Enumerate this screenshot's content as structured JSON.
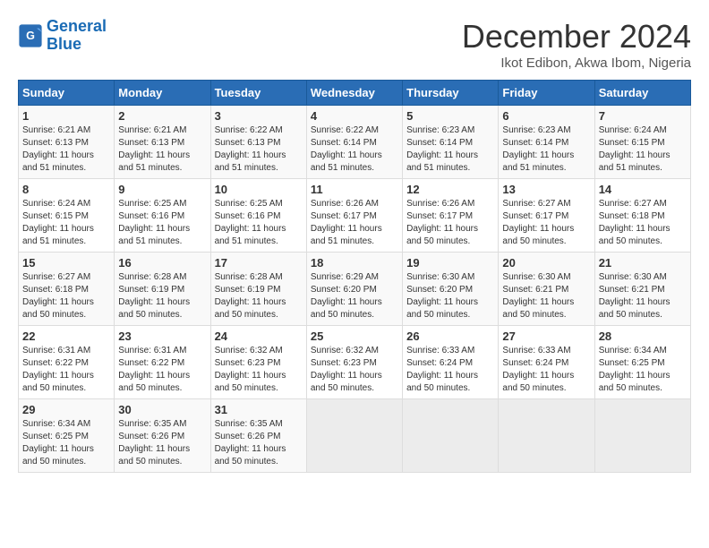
{
  "header": {
    "logo_line1": "General",
    "logo_line2": "Blue",
    "title": "December 2024",
    "location": "Ikot Edibon, Akwa Ibom, Nigeria"
  },
  "weekdays": [
    "Sunday",
    "Monday",
    "Tuesday",
    "Wednesday",
    "Thursday",
    "Friday",
    "Saturday"
  ],
  "weeks": [
    [
      {
        "day": "1",
        "info": "Sunrise: 6:21 AM\nSunset: 6:13 PM\nDaylight: 11 hours\nand 51 minutes."
      },
      {
        "day": "2",
        "info": "Sunrise: 6:21 AM\nSunset: 6:13 PM\nDaylight: 11 hours\nand 51 minutes."
      },
      {
        "day": "3",
        "info": "Sunrise: 6:22 AM\nSunset: 6:13 PM\nDaylight: 11 hours\nand 51 minutes."
      },
      {
        "day": "4",
        "info": "Sunrise: 6:22 AM\nSunset: 6:14 PM\nDaylight: 11 hours\nand 51 minutes."
      },
      {
        "day": "5",
        "info": "Sunrise: 6:23 AM\nSunset: 6:14 PM\nDaylight: 11 hours\nand 51 minutes."
      },
      {
        "day": "6",
        "info": "Sunrise: 6:23 AM\nSunset: 6:14 PM\nDaylight: 11 hours\nand 51 minutes."
      },
      {
        "day": "7",
        "info": "Sunrise: 6:24 AM\nSunset: 6:15 PM\nDaylight: 11 hours\nand 51 minutes."
      }
    ],
    [
      {
        "day": "8",
        "info": "Sunrise: 6:24 AM\nSunset: 6:15 PM\nDaylight: 11 hours\nand 51 minutes."
      },
      {
        "day": "9",
        "info": "Sunrise: 6:25 AM\nSunset: 6:16 PM\nDaylight: 11 hours\nand 51 minutes."
      },
      {
        "day": "10",
        "info": "Sunrise: 6:25 AM\nSunset: 6:16 PM\nDaylight: 11 hours\nand 51 minutes."
      },
      {
        "day": "11",
        "info": "Sunrise: 6:26 AM\nSunset: 6:17 PM\nDaylight: 11 hours\nand 51 minutes."
      },
      {
        "day": "12",
        "info": "Sunrise: 6:26 AM\nSunset: 6:17 PM\nDaylight: 11 hours\nand 50 minutes."
      },
      {
        "day": "13",
        "info": "Sunrise: 6:27 AM\nSunset: 6:17 PM\nDaylight: 11 hours\nand 50 minutes."
      },
      {
        "day": "14",
        "info": "Sunrise: 6:27 AM\nSunset: 6:18 PM\nDaylight: 11 hours\nand 50 minutes."
      }
    ],
    [
      {
        "day": "15",
        "info": "Sunrise: 6:27 AM\nSunset: 6:18 PM\nDaylight: 11 hours\nand 50 minutes."
      },
      {
        "day": "16",
        "info": "Sunrise: 6:28 AM\nSunset: 6:19 PM\nDaylight: 11 hours\nand 50 minutes."
      },
      {
        "day": "17",
        "info": "Sunrise: 6:28 AM\nSunset: 6:19 PM\nDaylight: 11 hours\nand 50 minutes."
      },
      {
        "day": "18",
        "info": "Sunrise: 6:29 AM\nSunset: 6:20 PM\nDaylight: 11 hours\nand 50 minutes."
      },
      {
        "day": "19",
        "info": "Sunrise: 6:30 AM\nSunset: 6:20 PM\nDaylight: 11 hours\nand 50 minutes."
      },
      {
        "day": "20",
        "info": "Sunrise: 6:30 AM\nSunset: 6:21 PM\nDaylight: 11 hours\nand 50 minutes."
      },
      {
        "day": "21",
        "info": "Sunrise: 6:30 AM\nSunset: 6:21 PM\nDaylight: 11 hours\nand 50 minutes."
      }
    ],
    [
      {
        "day": "22",
        "info": "Sunrise: 6:31 AM\nSunset: 6:22 PM\nDaylight: 11 hours\nand 50 minutes."
      },
      {
        "day": "23",
        "info": "Sunrise: 6:31 AM\nSunset: 6:22 PM\nDaylight: 11 hours\nand 50 minutes."
      },
      {
        "day": "24",
        "info": "Sunrise: 6:32 AM\nSunset: 6:23 PM\nDaylight: 11 hours\nand 50 minutes."
      },
      {
        "day": "25",
        "info": "Sunrise: 6:32 AM\nSunset: 6:23 PM\nDaylight: 11 hours\nand 50 minutes."
      },
      {
        "day": "26",
        "info": "Sunrise: 6:33 AM\nSunset: 6:24 PM\nDaylight: 11 hours\nand 50 minutes."
      },
      {
        "day": "27",
        "info": "Sunrise: 6:33 AM\nSunset: 6:24 PM\nDaylight: 11 hours\nand 50 minutes."
      },
      {
        "day": "28",
        "info": "Sunrise: 6:34 AM\nSunset: 6:25 PM\nDaylight: 11 hours\nand 50 minutes."
      }
    ],
    [
      {
        "day": "29",
        "info": "Sunrise: 6:34 AM\nSunset: 6:25 PM\nDaylight: 11 hours\nand 50 minutes."
      },
      {
        "day": "30",
        "info": "Sunrise: 6:35 AM\nSunset: 6:26 PM\nDaylight: 11 hours\nand 50 minutes."
      },
      {
        "day": "31",
        "info": "Sunrise: 6:35 AM\nSunset: 6:26 PM\nDaylight: 11 hours\nand 50 minutes."
      },
      {
        "day": "",
        "info": ""
      },
      {
        "day": "",
        "info": ""
      },
      {
        "day": "",
        "info": ""
      },
      {
        "day": "",
        "info": ""
      }
    ]
  ]
}
